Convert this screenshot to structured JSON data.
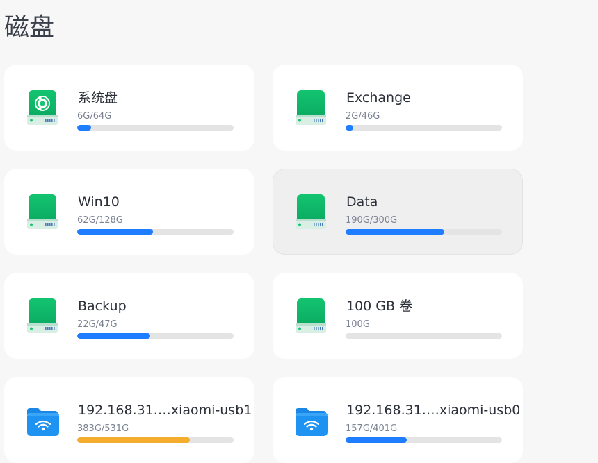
{
  "page": {
    "title": "磁盘"
  },
  "colors": {
    "progress_normal": "#1f7dff",
    "progress_warning": "#f5ad2e",
    "track": "#e4e4e4",
    "drive_green": "#19c773",
    "folder_blue": "#1e93f2"
  },
  "disks": [
    {
      "name": "系统盘",
      "usage": "6G/64G",
      "fraction": 0.09,
      "icon": "system-drive-icon",
      "level": "normal",
      "active": false
    },
    {
      "name": "Exchange",
      "usage": "2G/46G",
      "fraction": 0.05,
      "icon": "drive-icon",
      "level": "normal",
      "active": false
    },
    {
      "name": "Win10",
      "usage": "62G/128G",
      "fraction": 0.484,
      "icon": "drive-icon",
      "level": "normal",
      "active": false
    },
    {
      "name": "Data",
      "usage": "190G/300G",
      "fraction": 0.633,
      "icon": "drive-icon",
      "level": "normal",
      "active": true
    },
    {
      "name": "Backup",
      "usage": "22G/47G",
      "fraction": 0.468,
      "icon": "drive-icon",
      "level": "normal",
      "active": false
    },
    {
      "name": "100 GB 卷",
      "usage": "100G",
      "fraction": 0,
      "icon": "drive-icon",
      "level": "normal",
      "active": false
    },
    {
      "name": "192.168.31.…xiaomi-usb1",
      "usage": "383G/531G",
      "fraction": 0.721,
      "icon": "network-folder-icon",
      "level": "warning",
      "active": false
    },
    {
      "name": "192.168.31.…xiaomi-usb0",
      "usage": "157G/401G",
      "fraction": 0.392,
      "icon": "network-folder-icon",
      "level": "normal",
      "active": false
    }
  ]
}
